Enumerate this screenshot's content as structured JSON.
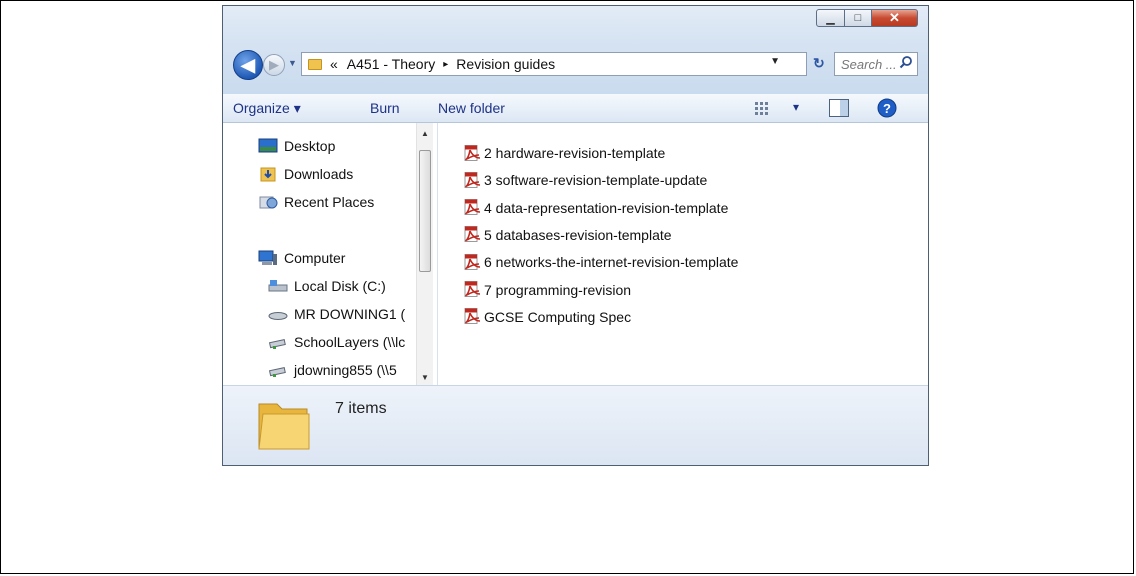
{
  "window": {
    "buttons": {
      "minimize": "▁",
      "maximize": "□",
      "close": "✕"
    }
  },
  "navigation": {
    "back_glyph": "◀",
    "forward_glyph": "▶",
    "dropdown_glyph": "▼",
    "address": {
      "overflow": "«",
      "crumbs": [
        "A451 - Theory",
        "Revision guides"
      ],
      "separator": "▸",
      "dropdown_glyph": "▼"
    },
    "refresh_glyph": "↻",
    "search": {
      "placeholder": "Search ..."
    }
  },
  "toolbar": {
    "organize": "Organize ▾",
    "burn": "Burn",
    "new_folder": "New folder",
    "views_dropdown": "▾"
  },
  "nav_pane": {
    "items": [
      {
        "label": "Desktop",
        "icon": "desktop-icon"
      },
      {
        "label": "Downloads",
        "icon": "downloads-icon"
      },
      {
        "label": "Recent Places",
        "icon": "recent-places-icon"
      },
      {
        "label": "Computer",
        "icon": "computer-icon"
      },
      {
        "label": "Local Disk (C:)",
        "icon": "local-disk-icon"
      },
      {
        "label": "MR DOWNING1 (",
        "icon": "removable-drive-icon"
      },
      {
        "label": "SchoolLayers (\\\\lc",
        "icon": "network-drive-icon"
      },
      {
        "label": "jdowning855 (\\\\5",
        "icon": "network-drive-icon"
      }
    ],
    "scroll_up": "▲",
    "scroll_down": "▼"
  },
  "files": [
    {
      "name": "2 hardware-revision-template",
      "icon": "pdf-icon"
    },
    {
      "name": "3 software-revision-template-update",
      "icon": "pdf-icon"
    },
    {
      "name": "4 data-representation-revision-template",
      "icon": "pdf-icon"
    },
    {
      "name": "5 databases-revision-template",
      "icon": "pdf-icon"
    },
    {
      "name": "6 networks-the-internet-revision-template",
      "icon": "pdf-icon"
    },
    {
      "name": "7 programming-revision",
      "icon": "pdf-icon"
    },
    {
      "name": "GCSE Computing Spec",
      "icon": "pdf-icon"
    }
  ],
  "status": {
    "item_count": "7 items"
  },
  "colors": {
    "chrome_gradient_top": "#e3ecf7",
    "chrome_gradient_bottom": "#c9dbee",
    "toolbar_text": "#1e3287",
    "close_button": "#c84b31",
    "pdf_red": "#c0281f"
  }
}
